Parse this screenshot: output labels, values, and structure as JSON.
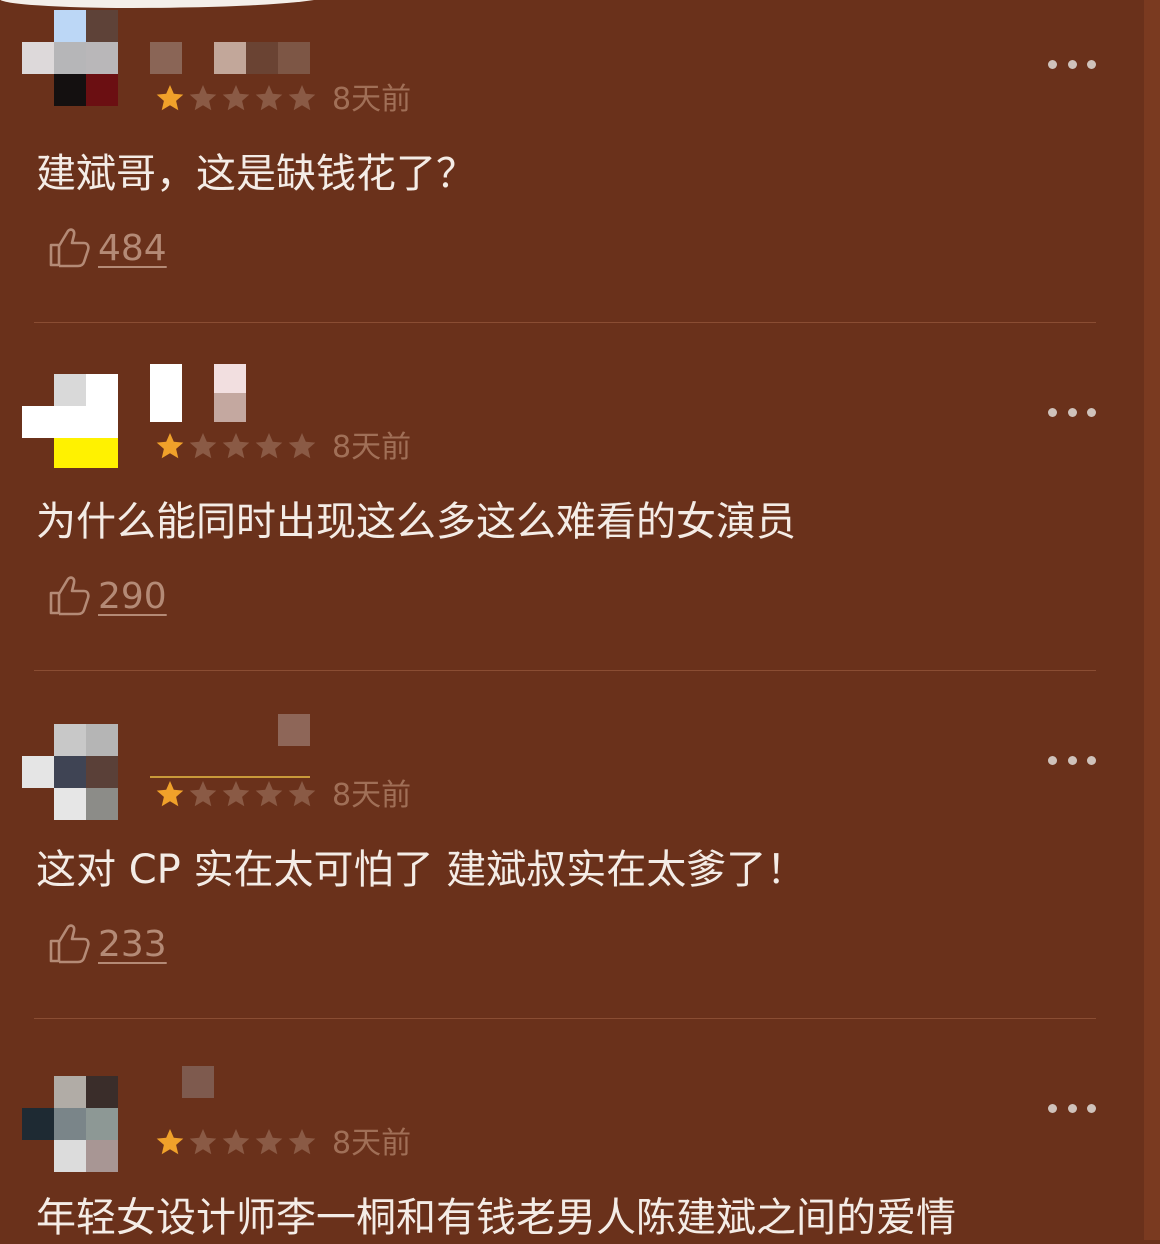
{
  "comments": [
    {
      "rating": 1,
      "max_rating": 5,
      "time": "8天前",
      "text": "建斌哥，这是缺钱花了？",
      "likes": "484"
    },
    {
      "rating": 1,
      "max_rating": 5,
      "time": "8天前",
      "text": "为什么能同时出现这么多这么难看的女演员",
      "likes": "290"
    },
    {
      "rating": 1,
      "max_rating": 5,
      "time": "8天前",
      "text": "这对 CP 实在太可怕了  建斌叔实在太爹了！",
      "likes": "233"
    },
    {
      "rating": 1,
      "max_rating": 5,
      "time": "8天前",
      "text": "年轻女设计师李一桐和有钱老男人陈建斌之间的爱情",
      "likes": ""
    }
  ],
  "colors": {
    "background": "#6a311b",
    "star_filled": "#f0a12a",
    "star_empty": "#8a5a45",
    "text": "#f4ece6",
    "meta": "#a06f57",
    "like": "#b48a76"
  },
  "icons": {
    "more": "more-dots-icon",
    "like": "thumb-up-icon",
    "star": "star-icon"
  }
}
